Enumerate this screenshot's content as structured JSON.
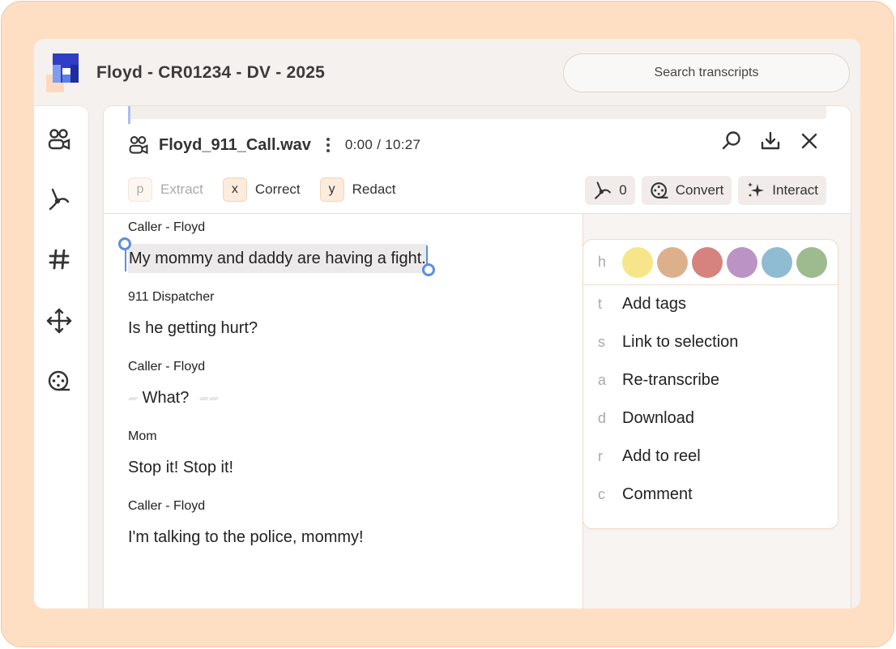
{
  "app": {
    "title": "Floyd - CR01234 - DV - 2025",
    "search_placeholder": "Search transcripts"
  },
  "file": {
    "name": "Floyd_911_Call.wav",
    "time": "0:00 / 10:27"
  },
  "modes": [
    {
      "key": "p",
      "label": "Extract"
    },
    {
      "key": "x",
      "label": "Correct"
    },
    {
      "key": "y",
      "label": "Redact"
    }
  ],
  "tools": {
    "clip_count": "0",
    "convert_label": "Convert",
    "interact_label": "Interact"
  },
  "transcript": [
    {
      "speaker": "Caller - Floyd",
      "text": "My mommy and daddy are having a fight."
    },
    {
      "speaker": "911 Dispatcher",
      "text": "Is he getting hurt?"
    },
    {
      "speaker": "Caller - Floyd",
      "text": "What?"
    },
    {
      "speaker": "Mom",
      "text": "Stop it! Stop it!"
    },
    {
      "speaker": "Caller - Floyd",
      "text": "I'm talking to the police, mommy!"
    }
  ],
  "context_menu": {
    "color_key": "h",
    "colors": [
      "#f7e58a",
      "#ddb08c",
      "#d6837f",
      "#bb93c4",
      "#8fbbd3",
      "#9dbb8f"
    ],
    "items": [
      {
        "key": "t",
        "label": "Add tags"
      },
      {
        "key": "s",
        "label": "Link to selection"
      },
      {
        "key": "a",
        "label": "Re-transcribe"
      },
      {
        "key": "d",
        "label": "Download"
      },
      {
        "key": "r",
        "label": "Add to reel"
      },
      {
        "key": "c",
        "label": "Comment"
      }
    ]
  },
  "colors": {
    "frame_bg": "#ffdfc4",
    "accent_blue": "#5b8fe0",
    "logo_blue": "#3b5bd9"
  }
}
